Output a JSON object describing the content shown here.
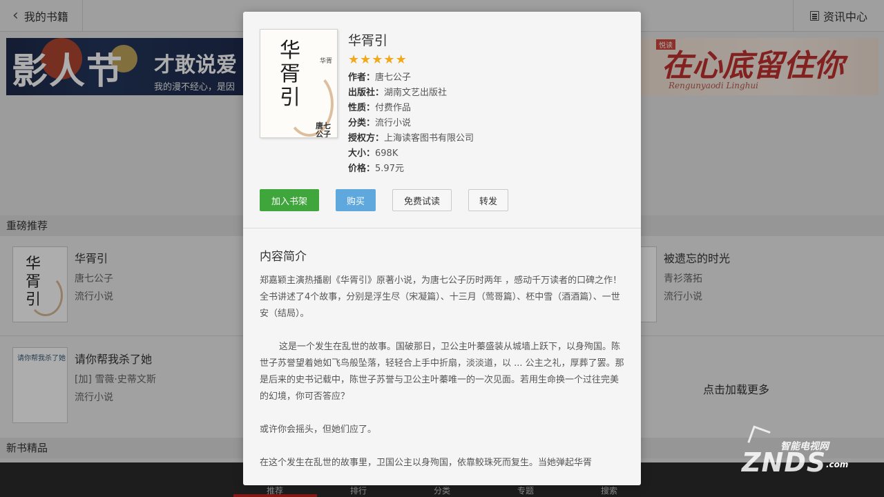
{
  "topbar": {
    "back_label": "我的书籍",
    "news_label": "资讯中心"
  },
  "banners": {
    "left": {
      "big": "影人节",
      "mid": "才敢说爱",
      "sub": "我的漫不经心，是因"
    },
    "right": {
      "tag": "悦读",
      "script": "在心底留住你",
      "foot": "Rengunyaodi  Linghui"
    }
  },
  "sections": {
    "featured": "重磅推荐",
    "new_books": "新书精品"
  },
  "books": [
    {
      "title": "华胥引",
      "author": "唐七公子",
      "category": "流行小说"
    },
    {
      "title": "被遗忘的时光",
      "author": "青衫落拓",
      "category": "流行小说"
    },
    {
      "title": "请你帮我杀了她",
      "author": "[加] 雪薇·史蒂文斯",
      "category": "流行小说"
    }
  ],
  "load_more": "点击加载更多",
  "tabs": [
    "推荐",
    "排行",
    "分类",
    "专题",
    "搜索"
  ],
  "watermark": {
    "cn": "智能电视网",
    "big": "ZNDS",
    "com": ".com"
  },
  "detail": {
    "title": "华胥引",
    "rating": 5,
    "cover": {
      "calligraphy": "华胥引",
      "author": "唐七公子",
      "side": "华胥"
    },
    "info": [
      {
        "label": "作者：",
        "value": "唐七公子"
      },
      {
        "label": "出版社：",
        "value": "湖南文艺出版社"
      },
      {
        "label": "性质：",
        "value": "付费作品"
      },
      {
        "label": "分类：",
        "value": "流行小说"
      },
      {
        "label": "授权方：",
        "value": "上海读客图书有限公司"
      },
      {
        "label": "大小：",
        "value": "698K"
      },
      {
        "label": "价格：",
        "value": "5.97元"
      }
    ],
    "buttons": {
      "add": "加入书架",
      "buy": "购买",
      "trial": "免费试读",
      "share": "转发"
    },
    "summary_title": "内容简介",
    "summary": [
      "郑嘉颖主演热播剧《华胥引》原著小说，为唐七公子历时两年 ，感动千万读者的口碑之作！",
      "全书讲述了4个故事，分别是浮生尽（宋凝篇）、十三月（莺哥篇）、柸中雪（酒酒篇）、一世安（结局）。",
      "这是一个发生在乱世的故事。国破那日，卫公主叶蓁盛装从城墙上跃下，以身殉国。陈世子苏誉望着她如飞鸟般坠落，轻轻合上手中折扇，淡淡道，以 ... 公主之礼，厚葬了罢。那是后来的史书记载中，陈世子苏誉与卫公主叶蓁唯一的一次见面。若用生命换一个过往完美的幻境，你可否答应？",
      "或许你会摇头，但她们应了。",
      "在这个发生在乱世的故事里，卫国公主以身殉国，依靠鲛珠死而复生。当她弹起华胥"
    ]
  },
  "colors": {
    "accent_green": "#3ea63a",
    "accent_blue": "#5fa8de",
    "star": "#f0a81c",
    "tab_active": "#c8241f"
  }
}
